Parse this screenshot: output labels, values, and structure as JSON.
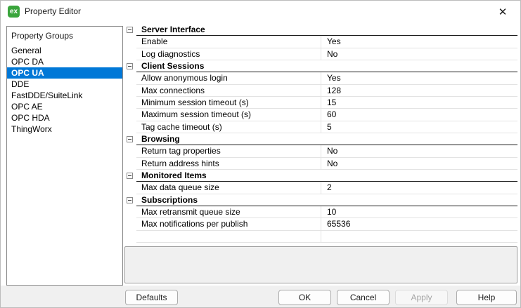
{
  "window": {
    "title": "Property Editor",
    "icon_text": "ex",
    "close_glyph": "✕"
  },
  "sidebar": {
    "header": "Property Groups",
    "items": [
      {
        "label": "General",
        "selected": false
      },
      {
        "label": "OPC DA",
        "selected": false
      },
      {
        "label": "OPC UA",
        "selected": true
      },
      {
        "label": "DDE",
        "selected": false
      },
      {
        "label": "FastDDE/SuiteLink",
        "selected": false
      },
      {
        "label": "OPC AE",
        "selected": false
      },
      {
        "label": "OPC HDA",
        "selected": false
      },
      {
        "label": "ThingWorx",
        "selected": false
      }
    ]
  },
  "property_grid": {
    "rows": [
      {
        "type": "group",
        "label": "Server Interface"
      },
      {
        "type": "property",
        "name": "Enable",
        "value": "Yes"
      },
      {
        "type": "property",
        "name": "Log diagnostics",
        "value": "No"
      },
      {
        "type": "group",
        "label": "Client Sessions"
      },
      {
        "type": "property",
        "name": "Allow anonymous login",
        "value": "Yes"
      },
      {
        "type": "property",
        "name": "Max connections",
        "value": "128"
      },
      {
        "type": "property",
        "name": "Minimum session timeout (s)",
        "value": "15"
      },
      {
        "type": "property",
        "name": "Maximum session timeout (s)",
        "value": "60"
      },
      {
        "type": "property",
        "name": "Tag cache timeout (s)",
        "value": "5"
      },
      {
        "type": "group",
        "label": "Browsing"
      },
      {
        "type": "property",
        "name": "Return tag properties",
        "value": "No"
      },
      {
        "type": "property",
        "name": "Return address hints",
        "value": "No"
      },
      {
        "type": "group",
        "label": "Monitored Items"
      },
      {
        "type": "property",
        "name": "Max data queue size",
        "value": "2"
      },
      {
        "type": "group",
        "label": "Subscriptions"
      },
      {
        "type": "property",
        "name": "Max retransmit queue size",
        "value": "10"
      },
      {
        "type": "property",
        "name": "Max notifications per publish",
        "value": "65536"
      },
      {
        "type": "empty"
      }
    ]
  },
  "description_panel": {
    "text": ""
  },
  "buttons": {
    "defaults": "Defaults",
    "ok": "OK",
    "cancel": "Cancel",
    "apply": "Apply",
    "help": "Help",
    "apply_enabled": false
  },
  "colors": {
    "selection_blue": "#0078d7",
    "icon_green": "#3aa53c",
    "group_line": "#1a1a1a",
    "row_line": "#e3e3e3"
  }
}
